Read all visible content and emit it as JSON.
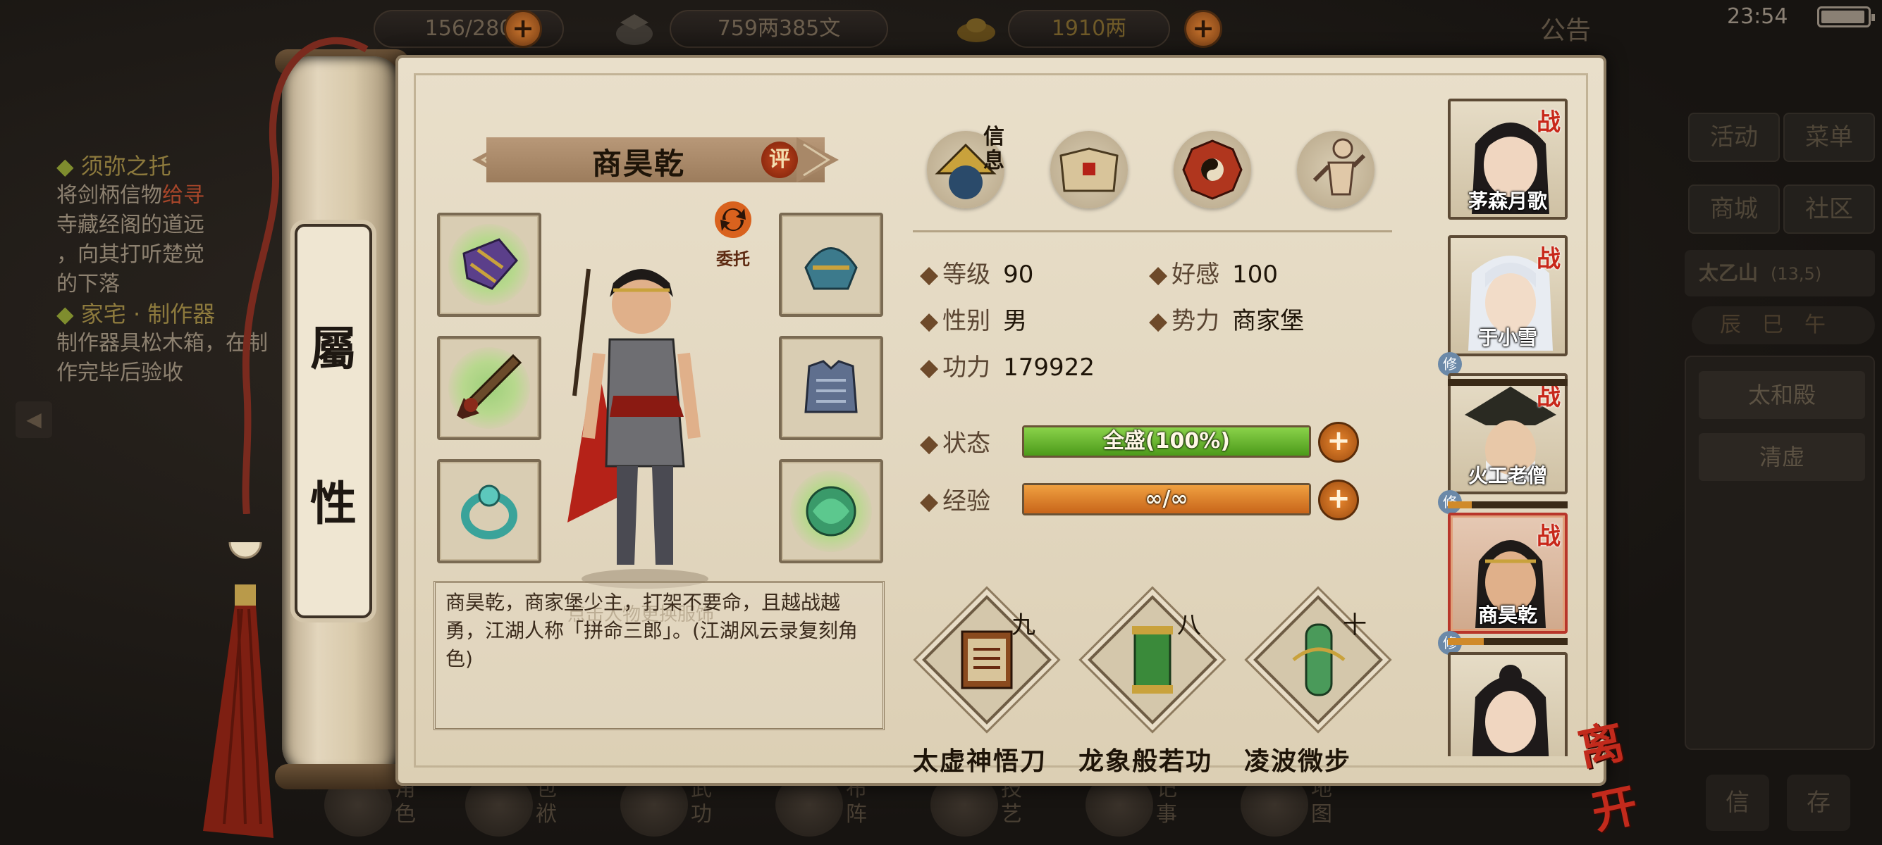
{
  "top_bar": {
    "stamina_value": "156/280",
    "money_value": "759两385文",
    "gold_value": "1910两",
    "notice_label": "公告",
    "clock": "23:54",
    "battery_level": 0.95
  },
  "quests": [
    {
      "title": "须弥之托",
      "text_parts": [
        "将剑柄信物",
        "给寻",
        "寺藏经阁的道远",
        "，向其打听楚觉",
        "的下落"
      ]
    },
    {
      "title": "家宅 · 制作器",
      "text": "制作器具松木箱，在制作完毕后验收"
    }
  ],
  "right_menu": {
    "activity": "活动",
    "menu": "菜单",
    "shop": "商城",
    "community": "社区",
    "location_name": "太乙山",
    "location_coord": "(13,5)",
    "time_label": "辰巳午",
    "places": [
      "太和殿",
      "清虚"
    ]
  },
  "bottom_bar": [
    "角色",
    "包袱",
    "武功",
    "布阵",
    "技艺",
    "记事",
    "地图"
  ],
  "bottom_right": [
    "信",
    "存"
  ],
  "scroll_tab": {
    "line1": "屬",
    "line2": "性"
  },
  "character": {
    "name": "商昊乾",
    "rate_badge": "评",
    "delegate_label": "委托",
    "outfit_hint": "点击人物更换服饰",
    "bio": "商昊乾，商家堡少主，打架不要命，且越战越勇，江湖人称「拼命三郎」。(江湖风云录复刻角色)"
  },
  "tabs": {
    "info_label": "信息"
  },
  "stats": {
    "level_label": "等级",
    "level": "90",
    "favor_label": "好感",
    "favor": "100",
    "gender_label": "性别",
    "gender": "男",
    "faction_label": "势力",
    "faction": "商家堡",
    "power_label": "功力",
    "power": "179922",
    "status_label": "状态",
    "status_text": "全盛(100%)",
    "status_fraction": 1.0,
    "exp_label": "经验",
    "exp_text": "∞/∞",
    "exp_fraction": 1.0
  },
  "skills": [
    {
      "level": "九",
      "name": "太虚神悟刀"
    },
    {
      "level": "八",
      "name": "龙象般若功"
    },
    {
      "level": "十",
      "name": "凌波微步"
    }
  ],
  "roster": [
    {
      "name": "茅森月歌",
      "badge": "战"
    },
    {
      "name": "于小雪",
      "badge": "战",
      "cultivate": "修"
    },
    {
      "name": "火工老僧",
      "badge": "战",
      "cultivate": "修"
    },
    {
      "name": "商昊乾",
      "badge": "战",
      "cultivate": "修"
    },
    {
      "name": ""
    }
  ],
  "leave_label": "离开",
  "colors": {
    "status_bar": "#5fae2a",
    "exp_bar": "#d8771c",
    "accent_red": "#c22a1c",
    "parchment": "#e3d8c1"
  }
}
